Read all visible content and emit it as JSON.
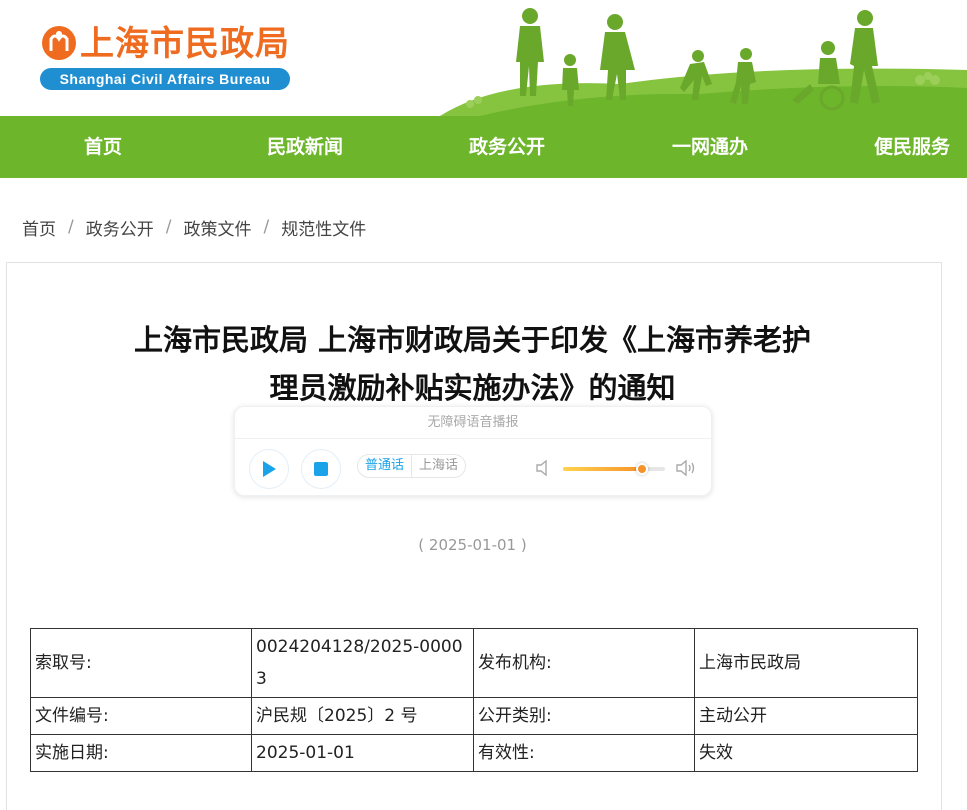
{
  "header": {
    "logo_cn": "上海市民政局",
    "logo_en": "Shanghai Civil Affairs Bureau",
    "brand_orange": "#ef6b1f",
    "brand_blue": "#1f8fd2"
  },
  "nav": {
    "color": "#6db52b",
    "items": [
      {
        "label": "首页"
      },
      {
        "label": "民政新闻"
      },
      {
        "label": "政务公开"
      },
      {
        "label": "一网通办"
      },
      {
        "label": "便民服务"
      }
    ]
  },
  "breadcrumb": {
    "items": [
      "首页",
      "政务公开",
      "政策文件",
      "规范性文件"
    ],
    "separator": "/"
  },
  "article": {
    "title_line1": "上海市民政局 上海市财政局关于印发《上海市养老护",
    "title_line2": "理员激励补贴实施办法》的通知",
    "date": "( 2025-01-01 )"
  },
  "player": {
    "title": "无障碍语音播报",
    "play_icon": "play-icon",
    "stop_icon": "stop-icon",
    "lang_active": "普通话",
    "lang_inactive": "上海话",
    "volume_level": 0.77,
    "accent": "#1aa3e8",
    "slider_color": "#f7922a"
  },
  "info": {
    "rows": [
      {
        "k1": "索取号:",
        "v1": "0024204128/2025-00003",
        "k2": "发布机构:",
        "v2": "上海市民政局"
      },
      {
        "k1": "文件编号:",
        "v1": "沪民规〔2025〕2 号",
        "k2": "公开类别:",
        "v2": "主动公开"
      },
      {
        "k1": "实施日期:",
        "v1": "2025-01-01",
        "k2": "有效性:",
        "v2": "失效"
      }
    ]
  }
}
